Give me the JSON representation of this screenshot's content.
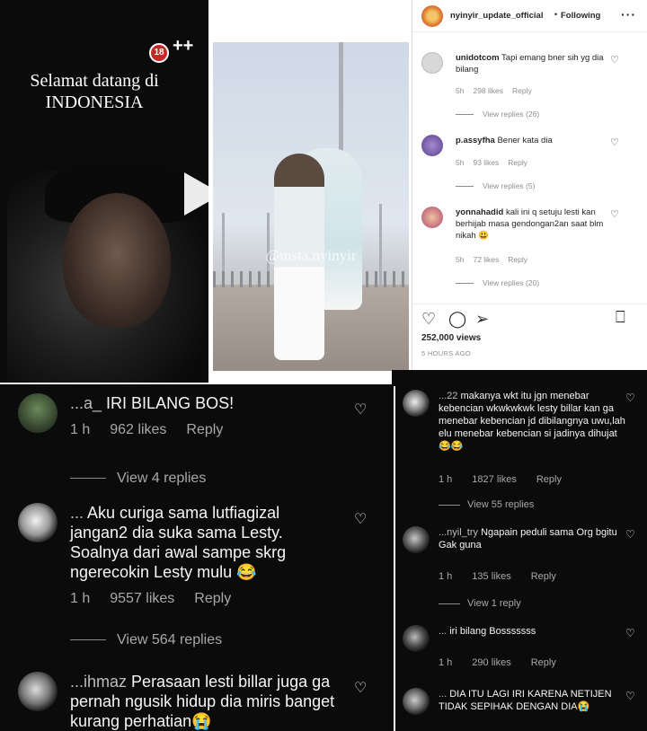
{
  "video": {
    "title_line1": "Selamat datang di",
    "title_line2": "INDONESIA",
    "badge": "18",
    "badge_suffix": "++"
  },
  "photo": {
    "watermark": "@insta.nyinyir"
  },
  "instagram": {
    "username": "nyinyir_update_official",
    "follow_label": "Following",
    "more": "···",
    "comments": [
      {
        "user": "unidotcom",
        "text": "Tapi emang bner sih yg dia bilang",
        "time": "5h",
        "likes": "298 likes",
        "reply": "Reply",
        "view_replies": "View replies (26)"
      },
      {
        "user": "p.assyfha",
        "text": "Bener kata dia",
        "time": "5h",
        "likes": "93 likes",
        "reply": "Reply",
        "view_replies": "View replies (5)"
      },
      {
        "user": "yonnahadid",
        "text": "kali ini q setuju lesti kan berhijab masa gendongan2an saat blm nikah 😃",
        "time": "5h",
        "likes": "72 likes",
        "reply": "Reply",
        "view_replies": "View replies (20)"
      }
    ],
    "views": "252,000 views",
    "time_ago": "5 HOURS AGO"
  },
  "left_comments": [
    {
      "user": "...a_",
      "text": "IRI BILANG BOS!",
      "time": "1 h",
      "likes": "962 likes",
      "reply": "Reply",
      "view_replies": "View 4 replies"
    },
    {
      "user": "...",
      "text": "Aku curiga sama lutfiagizal jangan2 dia suka sama Lesty. Soalnya dari awal sampe skrg ngerecokin Lesty mulu 😂",
      "time": "1 h",
      "likes": "9557 likes",
      "reply": "Reply",
      "view_replies": "View 564 replies"
    },
    {
      "user": "...ihmaz",
      "text": "Perasaan lesti billar juga ga pernah ngusik hidup dia miris banget kurang perhatian😭",
      "time": "",
      "likes": "",
      "reply": "",
      "view_replies": ""
    }
  ],
  "right_comments": [
    {
      "user": "...22",
      "text": "makanya wkt itu jgn menebar kebencian wkwkwkwk lesty billar kan ga menebar kebencian jd dibilangnya uwu,lah elu menebar kebencian si jadinya dihujat😂😂",
      "time": "1 h",
      "likes": "1827 likes",
      "reply": "Reply",
      "view_replies": "View 55 replies"
    },
    {
      "user": "...nyil_try",
      "text": "Ngapain peduli sama Org bgitu Gak guna",
      "time": "1 h",
      "likes": "135 likes",
      "reply": "Reply",
      "view_replies": "View 1 reply"
    },
    {
      "user": "...",
      "text": "iri bilang Bosssssss",
      "time": "1 h",
      "likes": "290 likes",
      "reply": "Reply",
      "view_replies": ""
    },
    {
      "user": "...",
      "text": "DIA ITU LAGI IRI KARENA NETIJEN TIDAK SEPIHAK DENGAN DIA😭",
      "time": "",
      "likes": "",
      "reply": "",
      "view_replies": ""
    }
  ]
}
